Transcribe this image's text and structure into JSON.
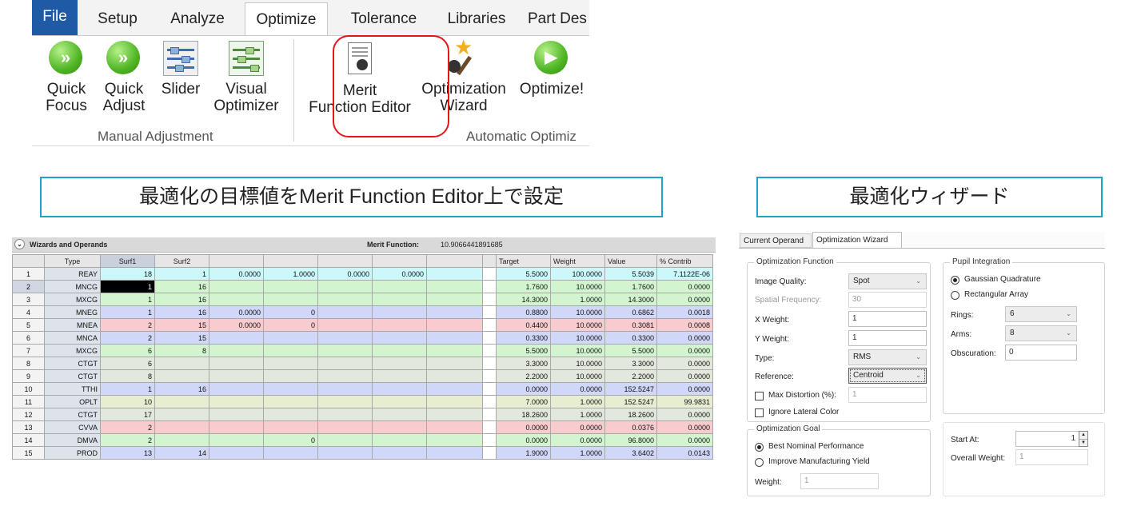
{
  "ribbon": {
    "tabs": [
      {
        "label": "File"
      },
      {
        "label": "Setup"
      },
      {
        "label": "Analyze"
      },
      {
        "label": "Optimize"
      },
      {
        "label": "Tolerance"
      },
      {
        "label": "Libraries"
      },
      {
        "label": "Part Des"
      }
    ],
    "buttons": {
      "quick_focus": [
        "Quick",
        "Focus"
      ],
      "quick_adjust": [
        "Quick",
        "Adjust"
      ],
      "slider": [
        "Slider"
      ],
      "visual_optimizer": [
        "Visual",
        "Optimizer"
      ],
      "merit_function_editor": [
        "Merit",
        "Function Editor"
      ],
      "optimization_wizard": [
        "Optimization",
        "Wizard"
      ],
      "optimize": [
        "Optimize!"
      ]
    },
    "groups": {
      "manual": "Manual Adjustment",
      "automatic": "Automatic Optimiz"
    },
    "highlight_color": "#e4161c"
  },
  "captions": {
    "left": "最適化の目標値をMerit Function Editor上で設定",
    "right": "最適化ウィザード",
    "border_color": "#1fa3c9"
  },
  "editor": {
    "title": "Wizards and Operands",
    "merit_label": "Merit Function:",
    "merit_value": "10.9066441891685",
    "columns": [
      "",
      "Type",
      "Surf1",
      "Surf2",
      "",
      "",
      "",
      "",
      "",
      "",
      "Target",
      "Weight",
      "Value",
      "% Contrib"
    ],
    "rows": [
      {
        "n": "1",
        "type": "REAY",
        "s1": "18",
        "s2": "1",
        "c1": "0.0000",
        "c2": "1.0000",
        "c3": "0.0000",
        "c4": "0.0000",
        "c5": "",
        "target": "5.5000",
        "weight": "100.0000",
        "value": "5.5039",
        "contrib": "7.1122E-06",
        "color": "cyan"
      },
      {
        "n": "2",
        "type": "MNCG",
        "s1": "1",
        "s2": "16",
        "c1": "",
        "c2": "",
        "c3": "",
        "c4": "",
        "c5": "",
        "target": "1.7600",
        "weight": "10.0000",
        "value": "1.7600",
        "contrib": "0.0000",
        "color": "green"
      },
      {
        "n": "3",
        "type": "MXCG",
        "s1": "1",
        "s2": "16",
        "c1": "",
        "c2": "",
        "c3": "",
        "c4": "",
        "c5": "",
        "target": "14.3000",
        "weight": "1.0000",
        "value": "14.3000",
        "contrib": "0.0000",
        "color": "green"
      },
      {
        "n": "4",
        "type": "MNEG",
        "s1": "1",
        "s2": "16",
        "c1": "0.0000",
        "c2": "0",
        "c3": "",
        "c4": "",
        "c5": "",
        "target": "0.8800",
        "weight": "10.0000",
        "value": "0.6862",
        "contrib": "0.0018",
        "color": "blue"
      },
      {
        "n": "5",
        "type": "MNEA",
        "s1": "2",
        "s2": "15",
        "c1": "0.0000",
        "c2": "0",
        "c3": "",
        "c4": "",
        "c5": "",
        "target": "0.4400",
        "weight": "10.0000",
        "value": "0.3081",
        "contrib": "0.0008",
        "color": "pink"
      },
      {
        "n": "6",
        "type": "MNCA",
        "s1": "2",
        "s2": "15",
        "c1": "",
        "c2": "",
        "c3": "",
        "c4": "",
        "c5": "",
        "target": "0.3300",
        "weight": "10.0000",
        "value": "0.3300",
        "contrib": "0.0000",
        "color": "blue"
      },
      {
        "n": "7",
        "type": "MXCG",
        "s1": "6",
        "s2": "8",
        "c1": "",
        "c2": "",
        "c3": "",
        "c4": "",
        "c5": "",
        "target": "5.5000",
        "weight": "10.0000",
        "value": "5.5000",
        "contrib": "0.0000",
        "color": "green"
      },
      {
        "n": "8",
        "type": "CTGT",
        "s1": "6",
        "s2": "",
        "c1": "",
        "c2": "",
        "c3": "",
        "c4": "",
        "c5": "",
        "target": "3.3000",
        "weight": "10.0000",
        "value": "3.3000",
        "contrib": "0.0000",
        "color": "gray"
      },
      {
        "n": "9",
        "type": "CTGT",
        "s1": "8",
        "s2": "",
        "c1": "",
        "c2": "",
        "c3": "",
        "c4": "",
        "c5": "",
        "target": "2.2000",
        "weight": "10.0000",
        "value": "2.2000",
        "contrib": "0.0000",
        "color": "gray"
      },
      {
        "n": "10",
        "type": "TTHI",
        "s1": "1",
        "s2": "16",
        "c1": "",
        "c2": "",
        "c3": "",
        "c4": "",
        "c5": "",
        "target": "0.0000",
        "weight": "0.0000",
        "value": "152.5247",
        "contrib": "0.0000",
        "color": "blue"
      },
      {
        "n": "11",
        "type": "OPLT",
        "s1": "10",
        "s2": "",
        "c1": "",
        "c2": "",
        "c3": "",
        "c4": "",
        "c5": "",
        "target": "7.0000",
        "weight": "1.0000",
        "value": "152.5247",
        "contrib": "99.9831",
        "color": "olive"
      },
      {
        "n": "12",
        "type": "CTGT",
        "s1": "17",
        "s2": "",
        "c1": "",
        "c2": "",
        "c3": "",
        "c4": "",
        "c5": "",
        "target": "18.2600",
        "weight": "1.0000",
        "value": "18.2600",
        "contrib": "0.0000",
        "color": "gray"
      },
      {
        "n": "13",
        "type": "CVVA",
        "s1": "2",
        "s2": "",
        "c1": "",
        "c2": "",
        "c3": "",
        "c4": "",
        "c5": "",
        "target": "0.0000",
        "weight": "0.0000",
        "value": "0.0376",
        "contrib": "0.0000",
        "color": "pink"
      },
      {
        "n": "14",
        "type": "DMVA",
        "s1": "2",
        "s2": "",
        "c1": "",
        "c2": "0",
        "c3": "",
        "c4": "",
        "c5": "",
        "target": "0.0000",
        "weight": "0.0000",
        "value": "96.8000",
        "contrib": "0.0000",
        "color": "green"
      },
      {
        "n": "15",
        "type": "PROD",
        "s1": "13",
        "s2": "14",
        "c1": "",
        "c2": "",
        "c3": "",
        "c4": "",
        "c5": "",
        "target": "1.9000",
        "weight": "1.0000",
        "value": "3.6402",
        "contrib": "0.0143",
        "color": "blue"
      }
    ]
  },
  "wizard": {
    "tabs": {
      "current_operand": "Current Operand",
      "optimization_wizard": "Optimization Wizard"
    },
    "optimization_function": {
      "title": "Optimization Function",
      "image_quality_label": "Image Quality:",
      "image_quality_value": "Spot",
      "spatial_frequency_label": "Spatial Frequency:",
      "spatial_frequency_value": "30",
      "x_weight_label": "X Weight:",
      "x_weight_value": "1",
      "y_weight_label": "Y Weight:",
      "y_weight_value": "1",
      "type_label": "Type:",
      "type_value": "RMS",
      "reference_label": "Reference:",
      "reference_value": "Centroid",
      "max_distortion_label": "Max Distortion (%):",
      "max_distortion_value": "1",
      "ignore_lateral_color_label": "Ignore Lateral Color"
    },
    "optimization_goal": {
      "title": "Optimization Goal",
      "best_nominal": "Best Nominal Performance",
      "improve_yield": "Improve Manufacturing Yield",
      "weight_label": "Weight:",
      "weight_value": "1"
    },
    "pupil_integration": {
      "title": "Pupil Integration",
      "gaussian": "Gaussian Quadrature",
      "rectangular": "Rectangular Array",
      "rings_label": "Rings:",
      "rings_value": "6",
      "arms_label": "Arms:",
      "arms_value": "8",
      "obscuration_label": "Obscuration:",
      "obscuration_value": "0"
    },
    "start_at_label": "Start At:",
    "start_at_value": "1",
    "overall_weight_label": "Overall Weight:",
    "overall_weight_value": "1"
  }
}
